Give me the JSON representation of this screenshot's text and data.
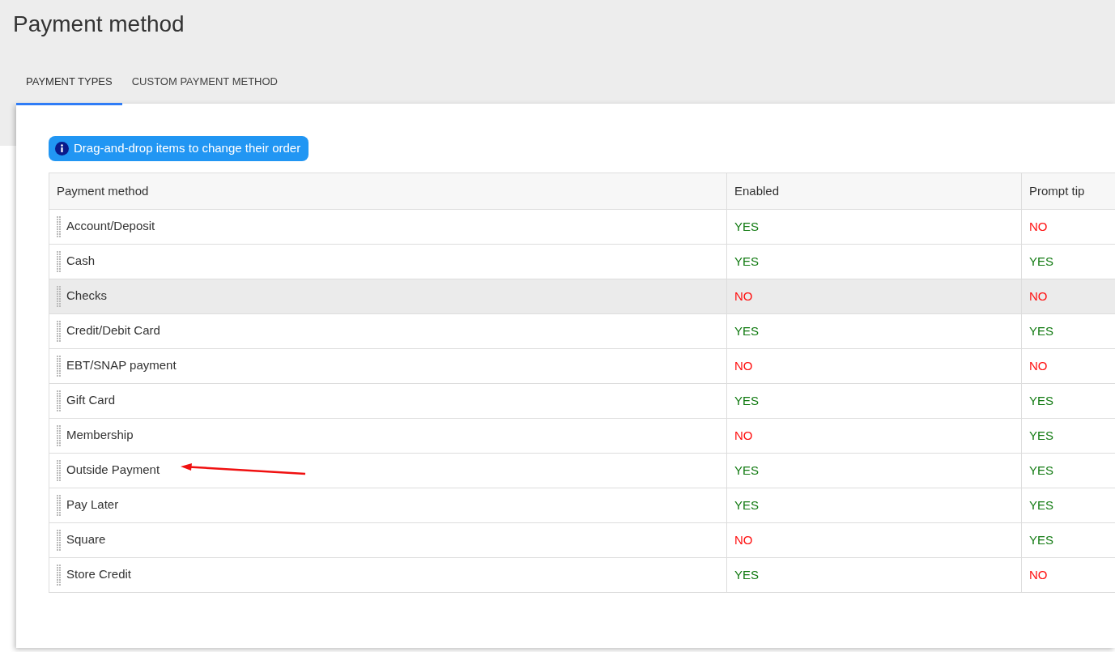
{
  "page": {
    "title": "Payment method"
  },
  "tabs": [
    {
      "label": "PAYMENT TYPES",
      "selected": true
    },
    {
      "label": "CUSTOM PAYMENT METHOD",
      "selected": false
    }
  ],
  "info_banner": {
    "text": "Drag-and-drop items to change their order"
  },
  "table": {
    "columns": [
      "Payment method",
      "Enabled",
      "Prompt tip"
    ],
    "rows": [
      {
        "name": "Account/Deposit",
        "enabled": {
          "text": "YES",
          "on": true
        },
        "prompt_tip": {
          "text": "NO",
          "on": false
        },
        "highlighted": false,
        "arrow": false
      },
      {
        "name": "Cash",
        "enabled": {
          "text": "YES",
          "on": true
        },
        "prompt_tip": {
          "text": "YES",
          "on": true
        },
        "highlighted": false,
        "arrow": false
      },
      {
        "name": "Checks",
        "enabled": {
          "text": "NO",
          "on": false
        },
        "prompt_tip": {
          "text": "NO",
          "on": false
        },
        "highlighted": true,
        "arrow": false
      },
      {
        "name": "Credit/Debit Card",
        "enabled": {
          "text": "YES",
          "on": true
        },
        "prompt_tip": {
          "text": "YES",
          "on": true
        },
        "highlighted": false,
        "arrow": false
      },
      {
        "name": "EBT/SNAP payment",
        "enabled": {
          "text": "NO",
          "on": false
        },
        "prompt_tip": {
          "text": "NO",
          "on": false
        },
        "highlighted": false,
        "arrow": false
      },
      {
        "name": "Gift Card",
        "enabled": {
          "text": "YES",
          "on": true
        },
        "prompt_tip": {
          "text": "YES",
          "on": true
        },
        "highlighted": false,
        "arrow": false
      },
      {
        "name": "Membership",
        "enabled": {
          "text": "NO",
          "on": false
        },
        "prompt_tip": {
          "text": "YES",
          "on": true
        },
        "highlighted": false,
        "arrow": false
      },
      {
        "name": "Outside Payment",
        "enabled": {
          "text": "YES",
          "on": true
        },
        "prompt_tip": {
          "text": "YES",
          "on": true
        },
        "highlighted": false,
        "arrow": true
      },
      {
        "name": "Pay Later",
        "enabled": {
          "text": "YES",
          "on": true
        },
        "prompt_tip": {
          "text": "YES",
          "on": true
        },
        "highlighted": false,
        "arrow": false
      },
      {
        "name": "Square",
        "enabled": {
          "text": "NO",
          "on": false
        },
        "prompt_tip": {
          "text": "YES",
          "on": true
        },
        "highlighted": false,
        "arrow": false
      },
      {
        "name": "Store Credit",
        "enabled": {
          "text": "YES",
          "on": true
        },
        "prompt_tip": {
          "text": "NO",
          "on": false
        },
        "highlighted": false,
        "arrow": false
      }
    ]
  }
}
